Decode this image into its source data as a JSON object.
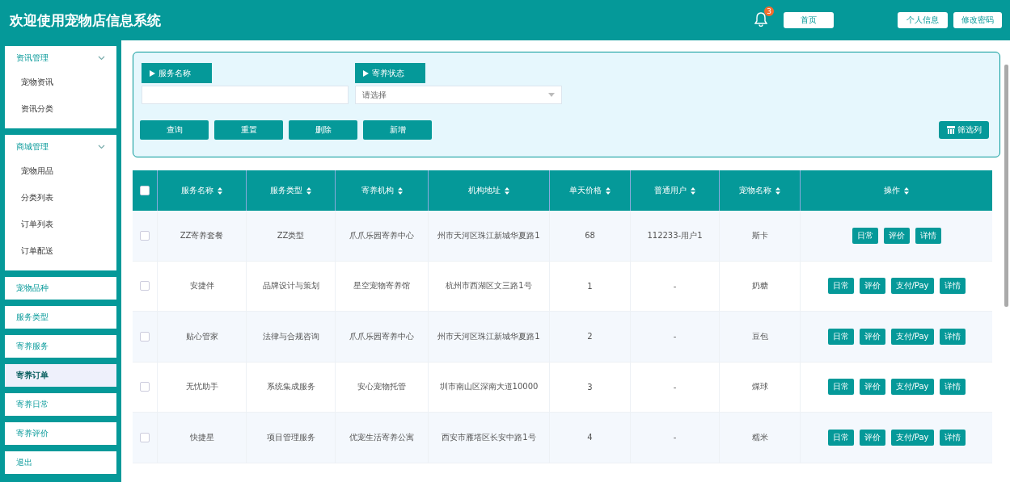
{
  "header": {
    "title": "欢迎使用宠物店信息系统",
    "notification_count": "3",
    "buttons": [
      "首页",
      "个人信息",
      "修改密码"
    ]
  },
  "sidebar": [
    {
      "label": "资讯管理",
      "expanded": true,
      "children": [
        {
          "label": "宠物资讯",
          "selected": false
        },
        {
          "label": "资讯分类",
          "selected": false
        }
      ]
    },
    {
      "label": "商城管理",
      "expanded": true,
      "children": [
        {
          "label": "宠物用品",
          "selected": false
        },
        {
          "label": "分类列表",
          "selected": false
        },
        {
          "label": "订单列表",
          "selected": false
        },
        {
          "label": "订单配送",
          "selected": false
        }
      ]
    },
    {
      "label": "宠物品种",
      "selected": false
    },
    {
      "label": "服务类型",
      "selected": false
    },
    {
      "label": "寄养服务",
      "selected": false
    },
    {
      "label": "寄养订单",
      "selected": true
    },
    {
      "label": "寄养日常",
      "selected": false
    },
    {
      "label": "寄养评价",
      "selected": false
    },
    {
      "label": "退出",
      "selected": false
    }
  ],
  "filters": [
    {
      "label": "服务名称",
      "kind": "text"
    },
    {
      "label": "寄养状态",
      "kind": "select",
      "placeholder": "请选择"
    }
  ],
  "actions": [
    "查询",
    "重置",
    "删除",
    "新增"
  ],
  "column_filter_button": "筛选列",
  "table": {
    "all_checked": false,
    "columns": [
      "服务名称",
      "服务类型",
      "寄养机构",
      "机构地址",
      "单天价格",
      "普通用户",
      "宠物名称",
      "操作"
    ],
    "rows": [
      {
        "checked": false,
        "cells": [
          "ZZ寄养套餐",
          "ZZ类型",
          "爪爪乐园寄养中心",
          "州市天河区珠江新城华夏路1",
          "68",
          "112233-用户1",
          "斯卡"
        ],
        "buttons": [
          "日常",
          "评价",
          "详情"
        ]
      },
      {
        "checked": false,
        "cells": [
          "安捷伴",
          "品牌设计与策划",
          "星空宠物寄养馆",
          "杭州市西湖区文三路1号",
          "1",
          "-",
          "奶糖"
        ],
        "buttons": [
          "日常",
          "评价",
          "支付/Pay",
          "详情"
        ]
      },
      {
        "checked": false,
        "cells": [
          "贴心管家",
          "法律与合规咨询",
          "爪爪乐园寄养中心",
          "州市天河区珠江新城华夏路1",
          "2",
          "-",
          "豆包"
        ],
        "buttons": [
          "日常",
          "评价",
          "支付/Pay",
          "详情"
        ]
      },
      {
        "checked": false,
        "cells": [
          "无忧助手",
          "系统集成服务",
          "安心宠物托管",
          "圳市南山区深南大道10000",
          "3",
          "-",
          "煤球"
        ],
        "buttons": [
          "日常",
          "评价",
          "支付/Pay",
          "详情"
        ]
      },
      {
        "checked": false,
        "cells": [
          "快捷星",
          "项目管理服务",
          "优宠生活寄养公寓",
          "西安市雁塔区长安中路1号",
          "4",
          "-",
          "糯米"
        ],
        "buttons": [
          "日常",
          "评价",
          "支付/Pay",
          "详情"
        ]
      }
    ]
  }
}
